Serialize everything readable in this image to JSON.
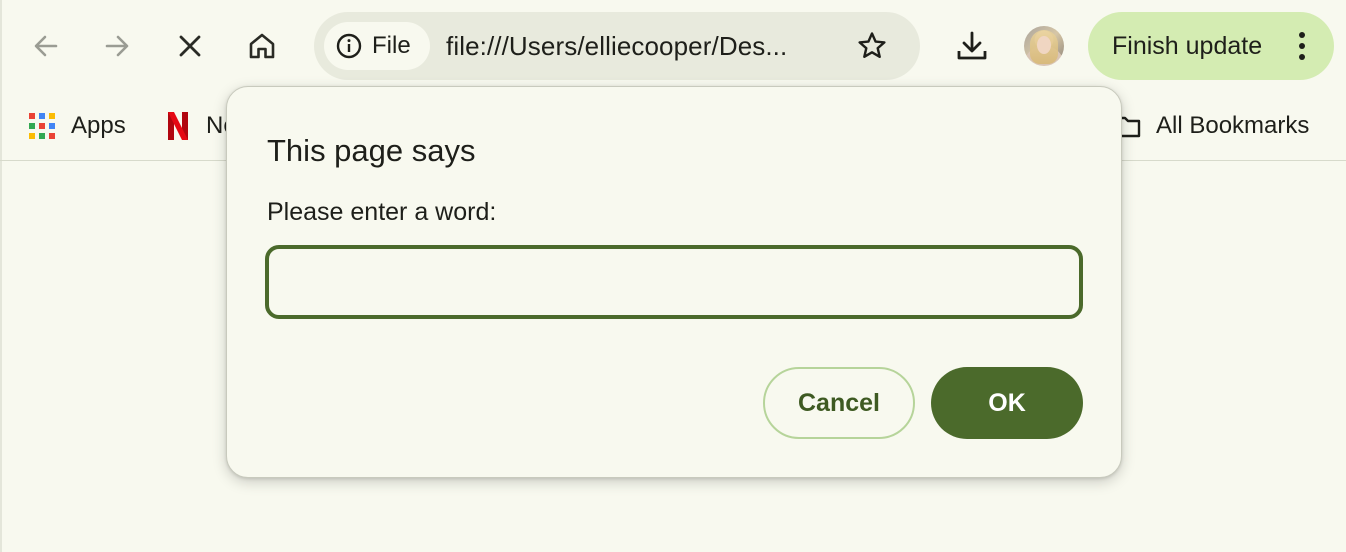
{
  "toolbar": {
    "back_icon": "arrow-left-icon",
    "forward_icon": "arrow-right-icon",
    "stop_icon": "close-icon",
    "home_icon": "home-icon",
    "site_chip_label": "File",
    "url": "file:///Users/elliecooper/Des...",
    "finish_update_label": "Finish update"
  },
  "bookmarks": {
    "apps_label": "Apps",
    "netflix_label": "Ne",
    "all_bookmarks_label": "All Bookmarks"
  },
  "dialog": {
    "title": "This page says",
    "message": "Please enter a word:",
    "input_value": "",
    "input_placeholder": "",
    "cancel_label": "Cancel",
    "ok_label": "OK"
  },
  "colors": {
    "background": "#f8f9ef",
    "omnibox": "#e8eadd",
    "finish_update_bg": "#d4ecb2",
    "accent": "#4b6a2b",
    "cancel_border": "#b6d49a",
    "netflix_red": "#e50914"
  }
}
